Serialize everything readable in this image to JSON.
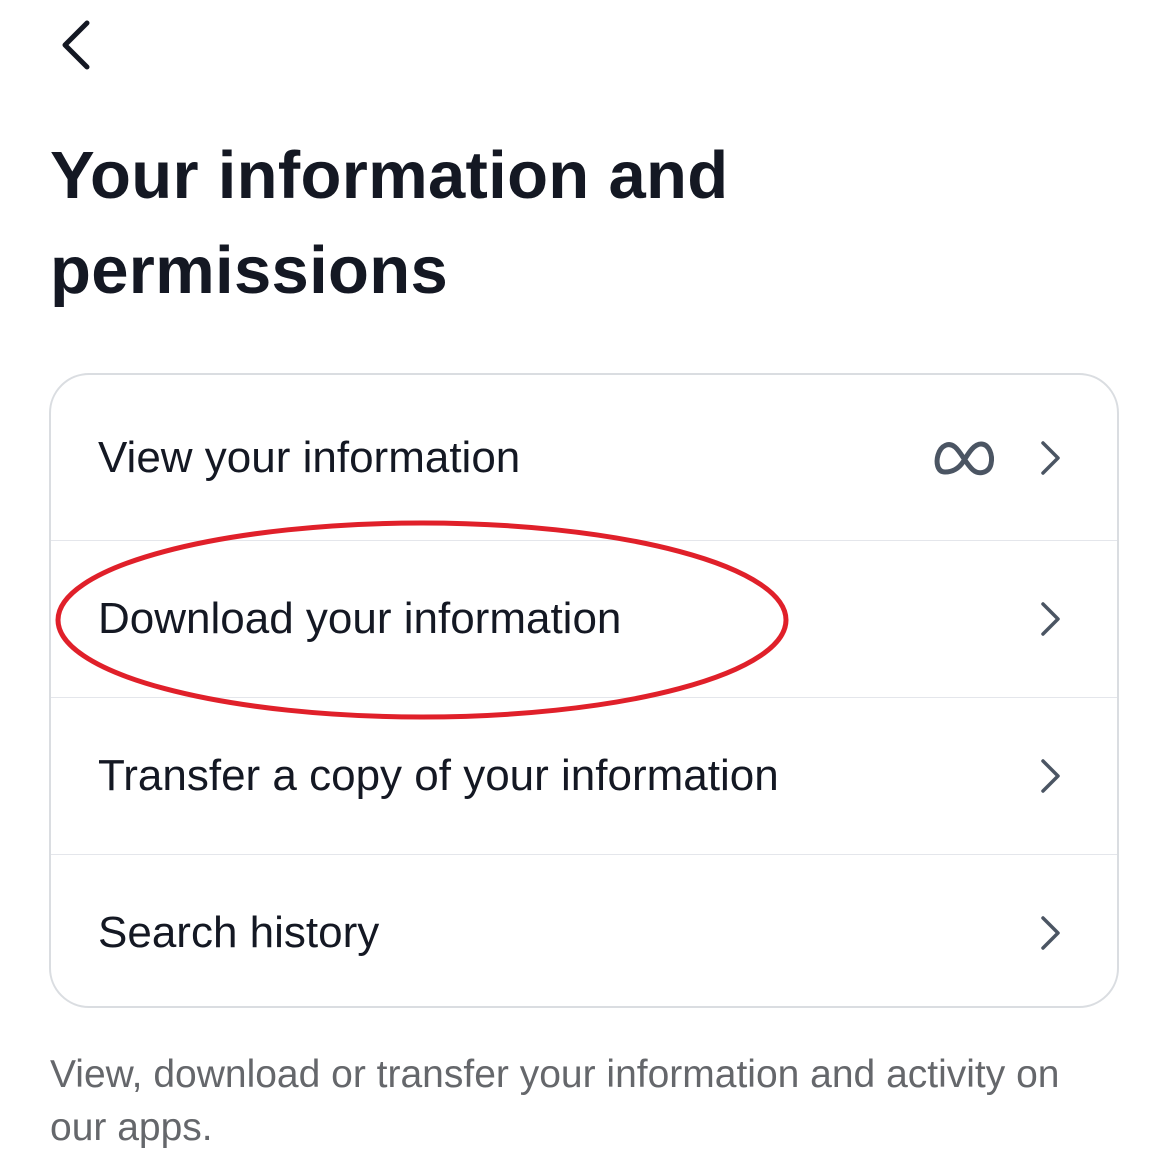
{
  "header": {
    "back_icon": "chevron-left-icon",
    "title": "Your information and permissions"
  },
  "menu": {
    "items": [
      {
        "label": "View your information",
        "icon": "meta-logo-icon",
        "chevron": "chevron-right-icon"
      },
      {
        "label": "Download your information",
        "chevron": "chevron-right-icon"
      },
      {
        "label": "Transfer a copy of your information",
        "chevron": "chevron-right-icon"
      },
      {
        "label": "Search history",
        "chevron": "chevron-right-icon"
      }
    ]
  },
  "footer": {
    "description": "View, download or transfer your information and activity on our apps."
  },
  "annotation": {
    "color": "#e0202a",
    "highlighted_item": "Download your information"
  },
  "colors": {
    "text_primary": "#141823",
    "text_secondary": "#65676b",
    "icon": "#4b5563",
    "border": "#dadde1"
  }
}
